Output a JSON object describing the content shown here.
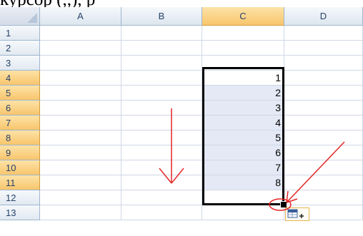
{
  "caption": "курсор (,,),         р",
  "spreadsheet": {
    "columns": [
      "A",
      "B",
      "C",
      "D"
    ],
    "selected_column": "C",
    "rows": [
      "1",
      "2",
      "3",
      "4",
      "5",
      "6",
      "7",
      "8",
      "9",
      "10",
      "11",
      "12",
      "13"
    ],
    "selected_rows": [
      "4",
      "5",
      "6",
      "7",
      "8",
      "9",
      "10",
      "11"
    ],
    "cells_c": [
      {
        "row": "4",
        "value": "1"
      },
      {
        "row": "5",
        "value": "2"
      },
      {
        "row": "6",
        "value": "3"
      },
      {
        "row": "7",
        "value": "4"
      },
      {
        "row": "8",
        "value": "5"
      },
      {
        "row": "9",
        "value": "6"
      },
      {
        "row": "10",
        "value": "7"
      },
      {
        "row": "11",
        "value": "8"
      }
    ]
  },
  "colors": {
    "annotation": "#e32626",
    "selection_border": "#000000",
    "header_highlight": "#f8c56c",
    "cell_highlight": "#e4e9f5"
  },
  "icons": {
    "autofill_options": "autofill-options-icon",
    "arrow_down": "down-arrow-annotation-icon",
    "arrow_diagonal": "diagonal-arrow-annotation-icon",
    "circle": "circle-annotation-icon"
  }
}
